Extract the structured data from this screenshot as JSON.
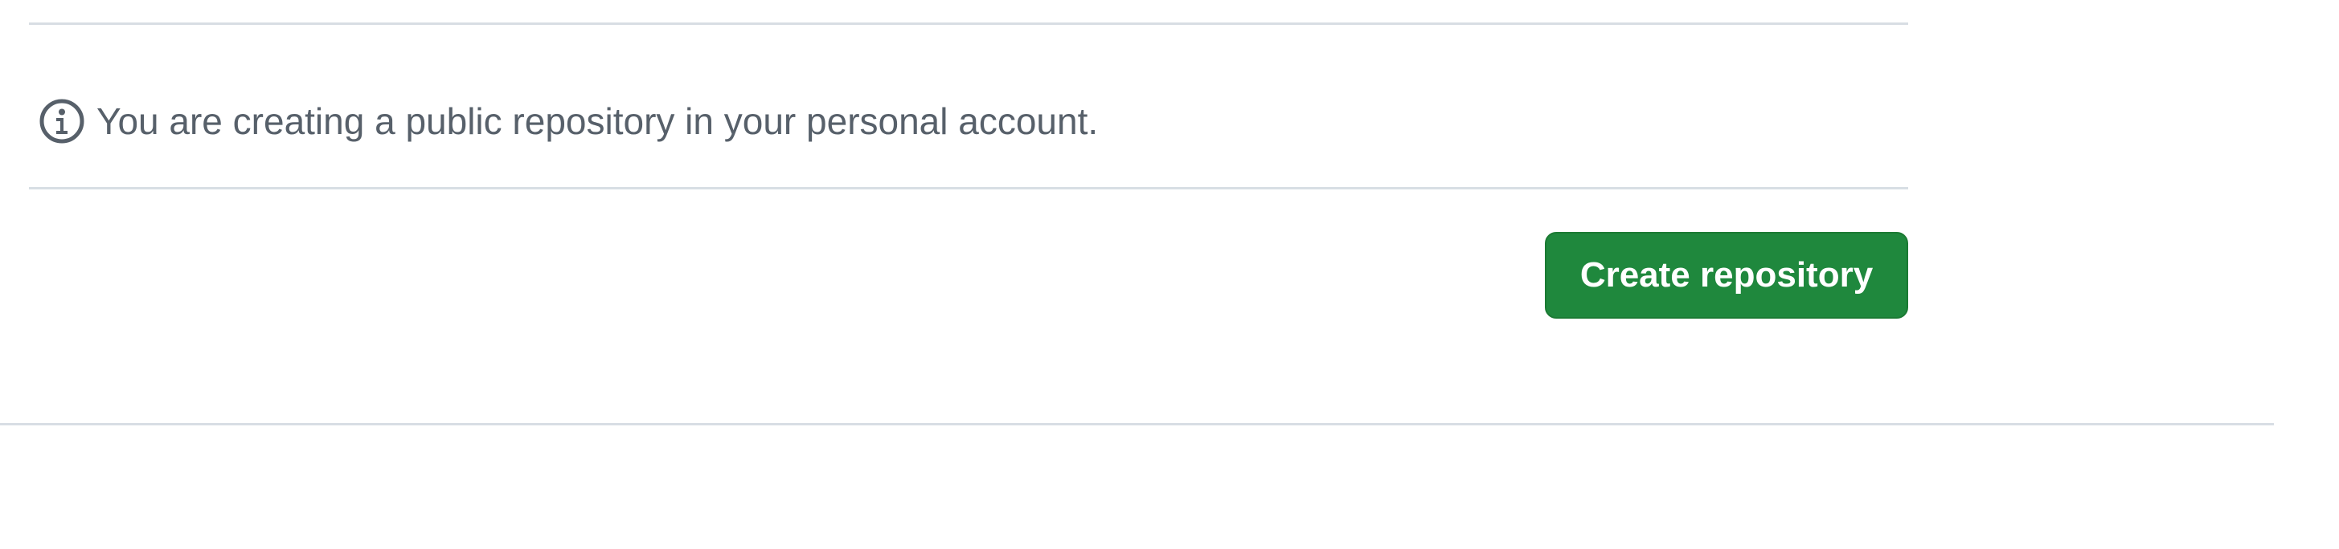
{
  "notice": {
    "icon": "info-icon",
    "text": "You are creating a public repository in your personal account."
  },
  "actions": {
    "create_label": "Create repository"
  },
  "colors": {
    "primary_button": "#1f883d",
    "muted_text": "#57606a",
    "divider": "#d8dee4"
  }
}
